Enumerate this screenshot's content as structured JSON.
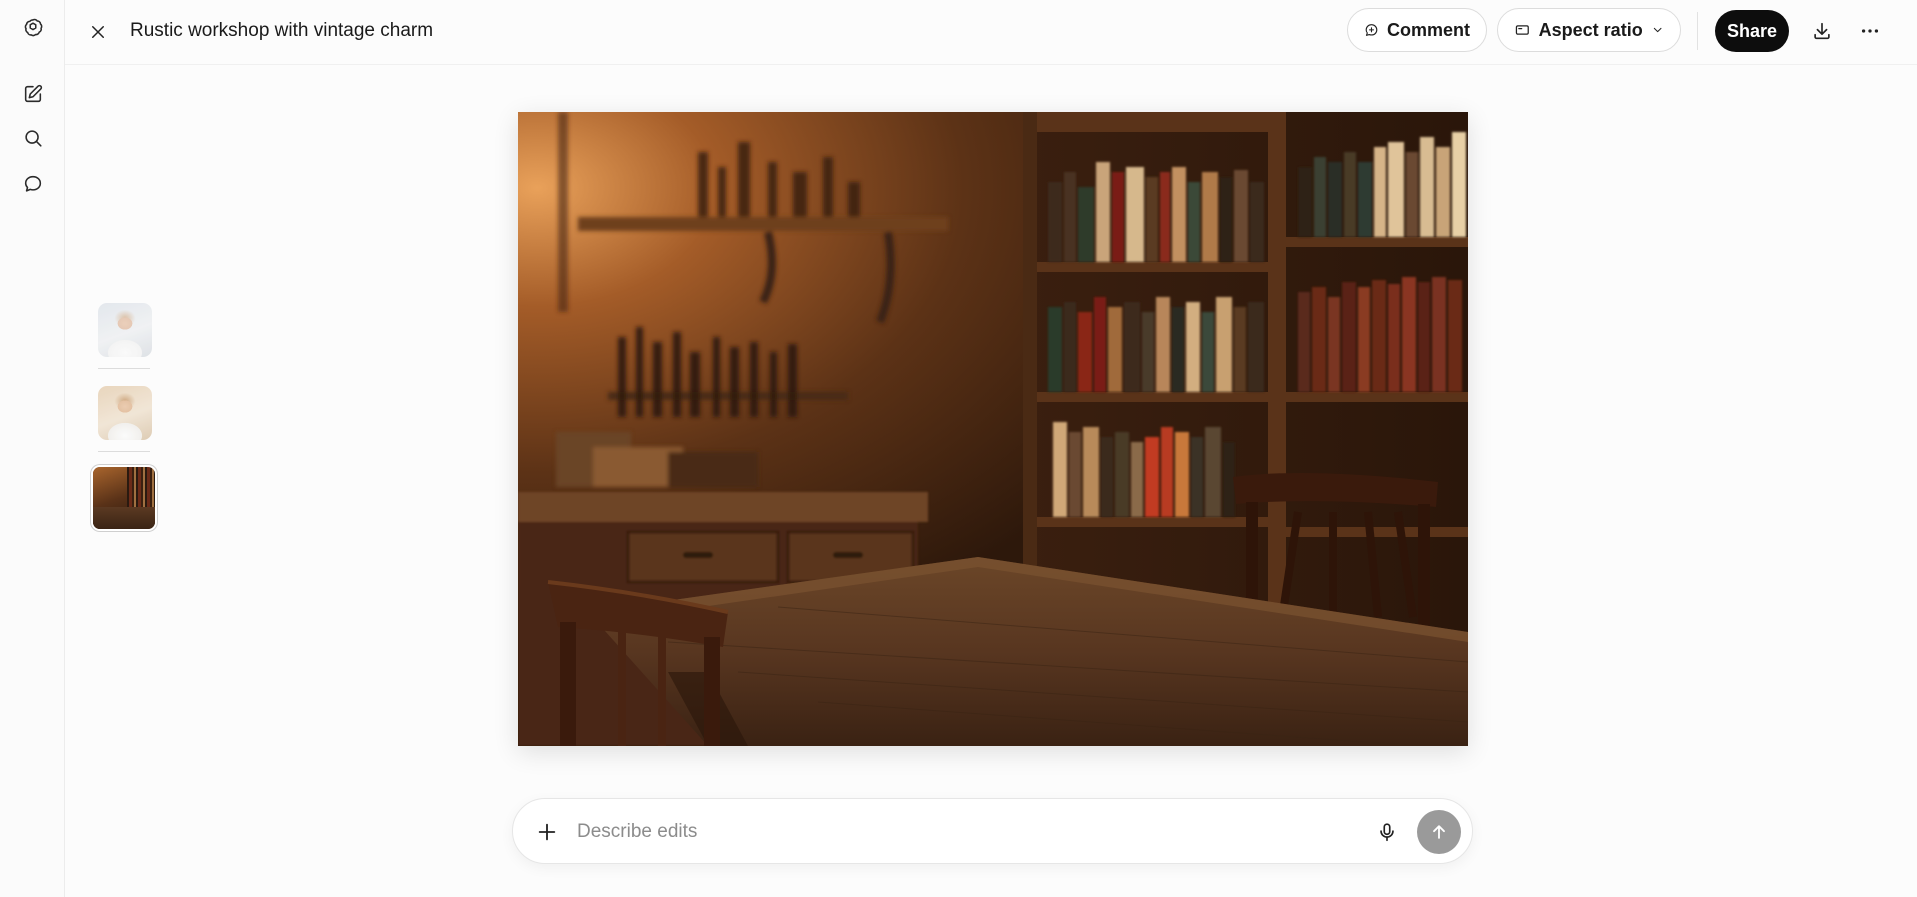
{
  "app": {
    "logo_icon": "openai-logo-icon"
  },
  "sidebar": {
    "items": [
      {
        "icon": "new-chat-icon"
      },
      {
        "icon": "search-icon"
      },
      {
        "icon": "chat-bubble-icon"
      }
    ]
  },
  "header": {
    "close_icon": "close-icon",
    "title": "Rustic workshop with vintage charm",
    "comment_label": "Comment",
    "aspect_label": "Aspect ratio",
    "share_label": "Share",
    "download_icon": "download-icon",
    "more_icon": "more-horizontal-icon"
  },
  "history": {
    "thumbnails": [
      {
        "subject": "person in white shirt",
        "selected": false
      },
      {
        "subject": "person in white shirt, warm tone",
        "selected": false
      },
      {
        "subject": "rustic workshop",
        "selected": true
      }
    ]
  },
  "image": {
    "subject": "Rustic workshop with vintage charm"
  },
  "composer": {
    "placeholder": "Describe edits",
    "value": "",
    "plus_icon": "plus-icon",
    "mic_icon": "microphone-icon",
    "send_icon": "arrow-up-icon"
  },
  "colors": {
    "accent": "#0d0d0d",
    "send_disabled": "#9a9a9a"
  }
}
